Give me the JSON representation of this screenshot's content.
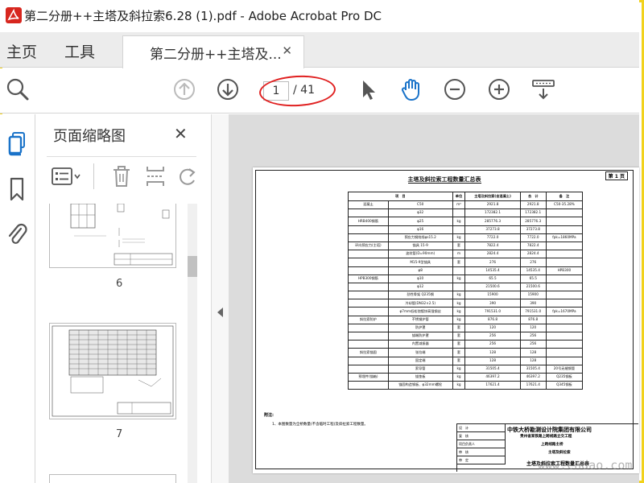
{
  "window": {
    "title": "第二分册++主塔及斜拉索6.28 (1).pdf - Adobe Acrobat Pro DC"
  },
  "tabs": {
    "home": "主页",
    "tools": "工具",
    "document": "第二分册++主塔及..."
  },
  "toolbar": {
    "current_page": "1",
    "total_pages": "/ 41"
  },
  "thumbnail_panel": {
    "title": "页面缩略图",
    "thumbnails": [
      {
        "label": "6"
      },
      {
        "label": "7"
      }
    ]
  },
  "document": {
    "sheet_number": "第 1 页",
    "title": "主塔及斜拉索工程数量汇总表",
    "table": {
      "headers": [
        "项　目",
        "单位",
        "主塔及斜拉索(含混凝土)",
        "合　计",
        "备　注"
      ],
      "rows": [
        [
          "混凝土",
          "C50",
          "m³",
          "2921.8",
          "2921.8",
          "C50-35.28%"
        ],
        [
          "",
          "φ32",
          "",
          "172382.1",
          "172382.1",
          ""
        ],
        [
          "HRB400钢筋",
          "φ25",
          "kg",
          "285776.3",
          "285776.3",
          ""
        ],
        [
          "",
          "φ16",
          "",
          "37273.8",
          "37273.8",
          ""
        ],
        [
          "",
          "预应力钢绞线φs15.2",
          "kg",
          "7722.0",
          "7722.0",
          "fpk=1860MPa"
        ],
        [
          "环向预应力(主塔)",
          "锚具 15-9",
          "套",
          "7822.4",
          "7822.4",
          ""
        ],
        [
          "",
          "波纹管(D=90mm)",
          "m",
          "2824.4",
          "2824.4",
          ""
        ],
        [
          "",
          "M15-9型锚具",
          "套",
          "276",
          "276",
          ""
        ],
        [
          "",
          "φ8",
          "",
          "14535.4",
          "14535.4",
          "HPB300"
        ],
        [
          "HPB300钢筋",
          "φ10",
          "kg",
          "65.5",
          "65.5",
          ""
        ],
        [
          "",
          "φ12",
          "",
          "21500.6",
          "21500.6",
          ""
        ],
        [
          "",
          "劲性骨架 Q235钢",
          "kg",
          "15900",
          "15900",
          ""
        ],
        [
          "",
          "冷却管(DN32×2.5)",
          "kg",
          "390",
          "390",
          ""
        ],
        [
          "",
          "φ7mm低松弛镀锌高强钢丝",
          "kg",
          "791531.0",
          "791531.0",
          "fpk=1670MPa"
        ],
        [
          "斜拉索防护",
          "不锈钢护管",
          "kg",
          "876.8",
          "876.8",
          ""
        ],
        [
          "",
          "防护罩",
          "套",
          "120",
          "120",
          ""
        ],
        [
          "",
          "锚端防护罩",
          "套",
          "256",
          "256",
          ""
        ],
        [
          "",
          "内置减振器",
          "套",
          "256",
          "256",
          ""
        ],
        [
          "斜拉索锚固",
          "张拉端",
          "套",
          "128",
          "128",
          ""
        ],
        [
          "",
          "固定端",
          "套",
          "128",
          "128",
          ""
        ],
        [
          "",
          "索导管",
          "kg",
          "31505.4",
          "31505.4",
          "20号无缝钢管"
        ],
        [
          "预埋件(锚箱)",
          "锚垫板",
          "kg",
          "46397.2",
          "46397.2",
          "Q235钢板"
        ],
        [
          "",
          "锚固构造钢板、φ32mm螺栓",
          "kg",
          "17621.4",
          "17621.4",
          "Q345钢板"
        ]
      ]
    },
    "notes_label": "附注:",
    "notes_text": "1、本图数量为全桥数量(不含临时工程)及斜拉索工程数量。",
    "title_block": {
      "rows": [
        "设　计",
        "复　核",
        "项目负责人",
        "审　核",
        "审　定"
      ],
      "company": "中铁大桥勘测设计院集团有限公司",
      "project": "贵州省某铁路上跨线路立交工程",
      "project_line2": "上跨线路主桥",
      "project_line3": "主塔及斜拉索",
      "drawing_name": "主塔及斜拉索工程数量汇总表"
    }
  },
  "watermark": "www.cndao.com",
  "colors": {
    "accent_blue": "#1a73c9",
    "highlight_oval": "#e02020",
    "frame": "#f2d21c"
  }
}
